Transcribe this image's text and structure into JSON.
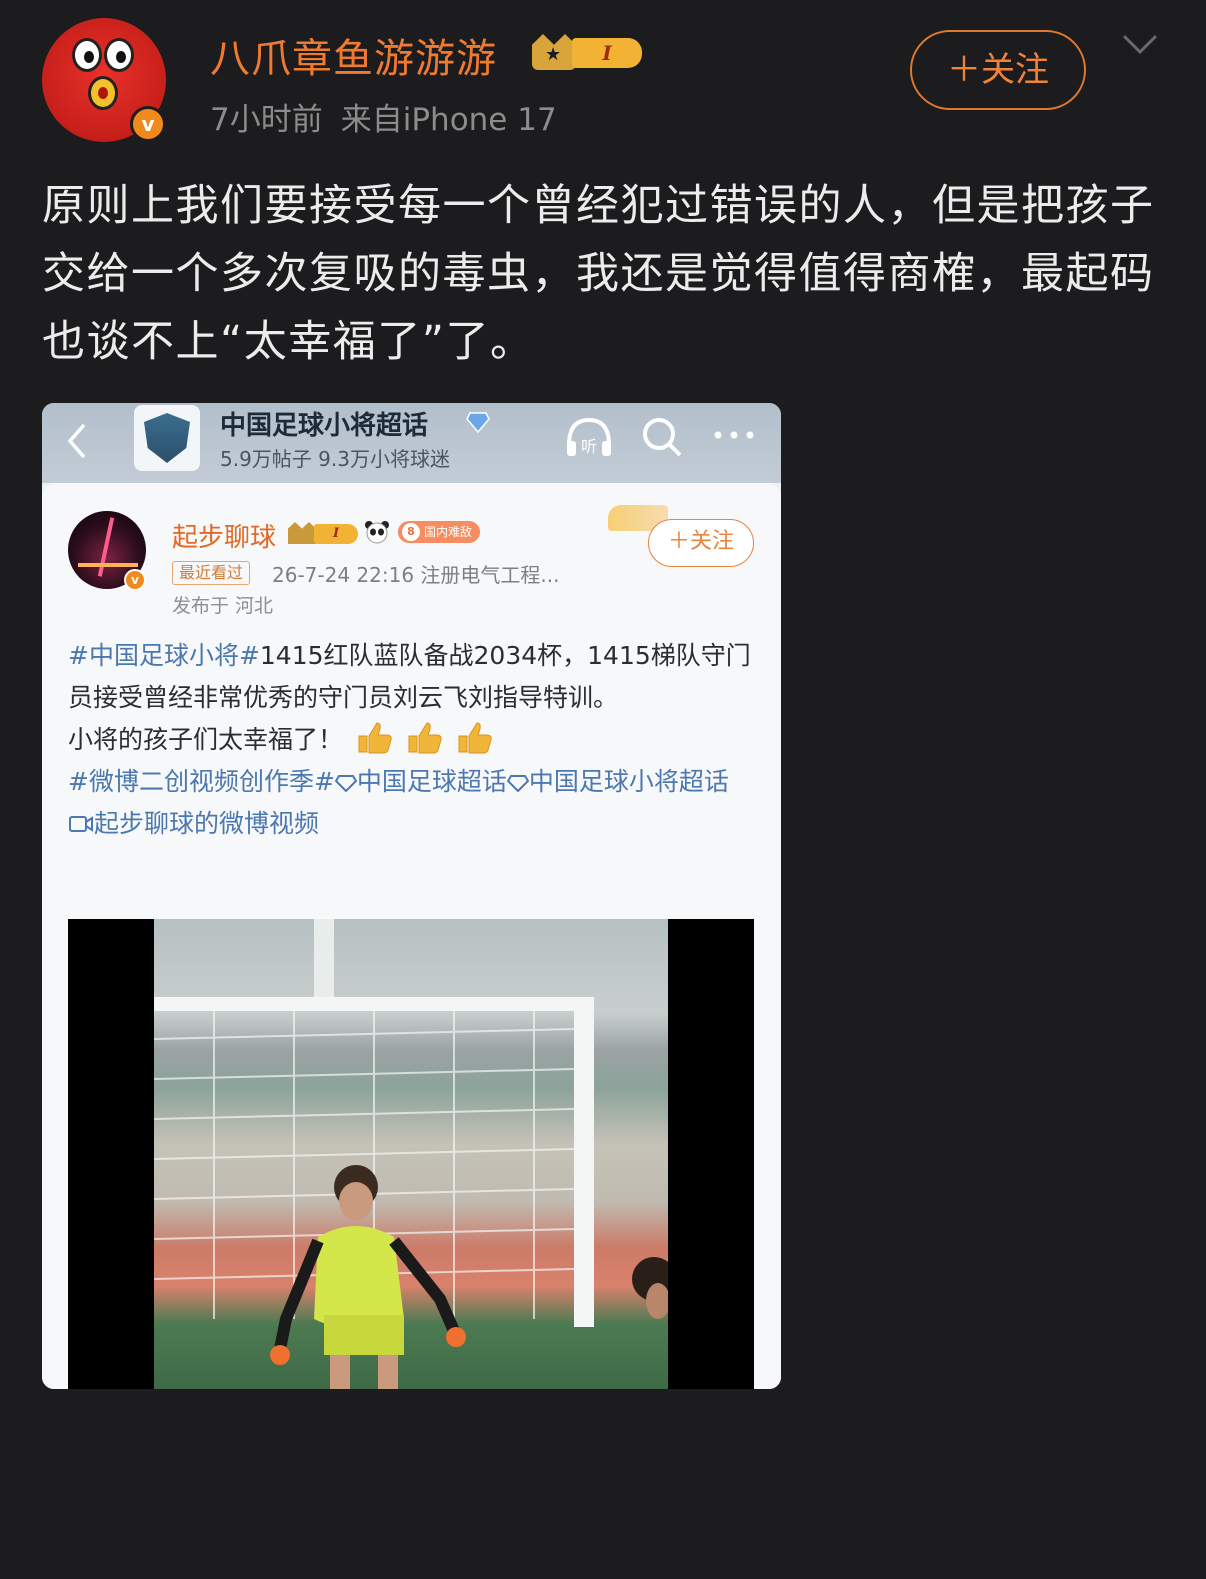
{
  "header": {
    "username": "八爪章鱼游游游",
    "level": "I",
    "time": "7小时前",
    "source": "来自iPhone 17",
    "follow_label": "＋关注",
    "verified": "v"
  },
  "post": {
    "text": "原则上我们要接受每一个曾经犯过错误的人，但是把孩子交给一个多次复吸的毒虫，我还是觉得值得商榷，最起码也谈不上“太幸福了”了。"
  },
  "embed": {
    "topbar": {
      "title": "中国足球小将超话",
      "stats": "5.9万帖子 9.3万小将球迷",
      "listen_label": "听"
    },
    "card": {
      "username": "起步聊球",
      "level": "I",
      "tag": "国内难敌",
      "recent": "最近看过",
      "meta": "26-7-24 22:16  注册电气工程...",
      "location": "发布于 河北",
      "follow_label": "＋关注",
      "verified": "v",
      "body": {
        "hashtag1": "#中国足球小将#",
        "line1": "1415红队蓝队备战2034杯，1415梯队守门员接受曾经非常优秀的守门员刘云飞刘指导特训。",
        "line2": "小将的孩子们太幸福了！",
        "hashtag2": "#微博二创视频创作季#",
        "link1": "中国足球超话",
        "link2": "中国足球小将超话",
        "video_link": "起步聊球的微博视频"
      }
    }
  },
  "colors": {
    "accent": "#f07a30",
    "background": "#1c1c1e",
    "link_blue": "#4c78b0"
  }
}
